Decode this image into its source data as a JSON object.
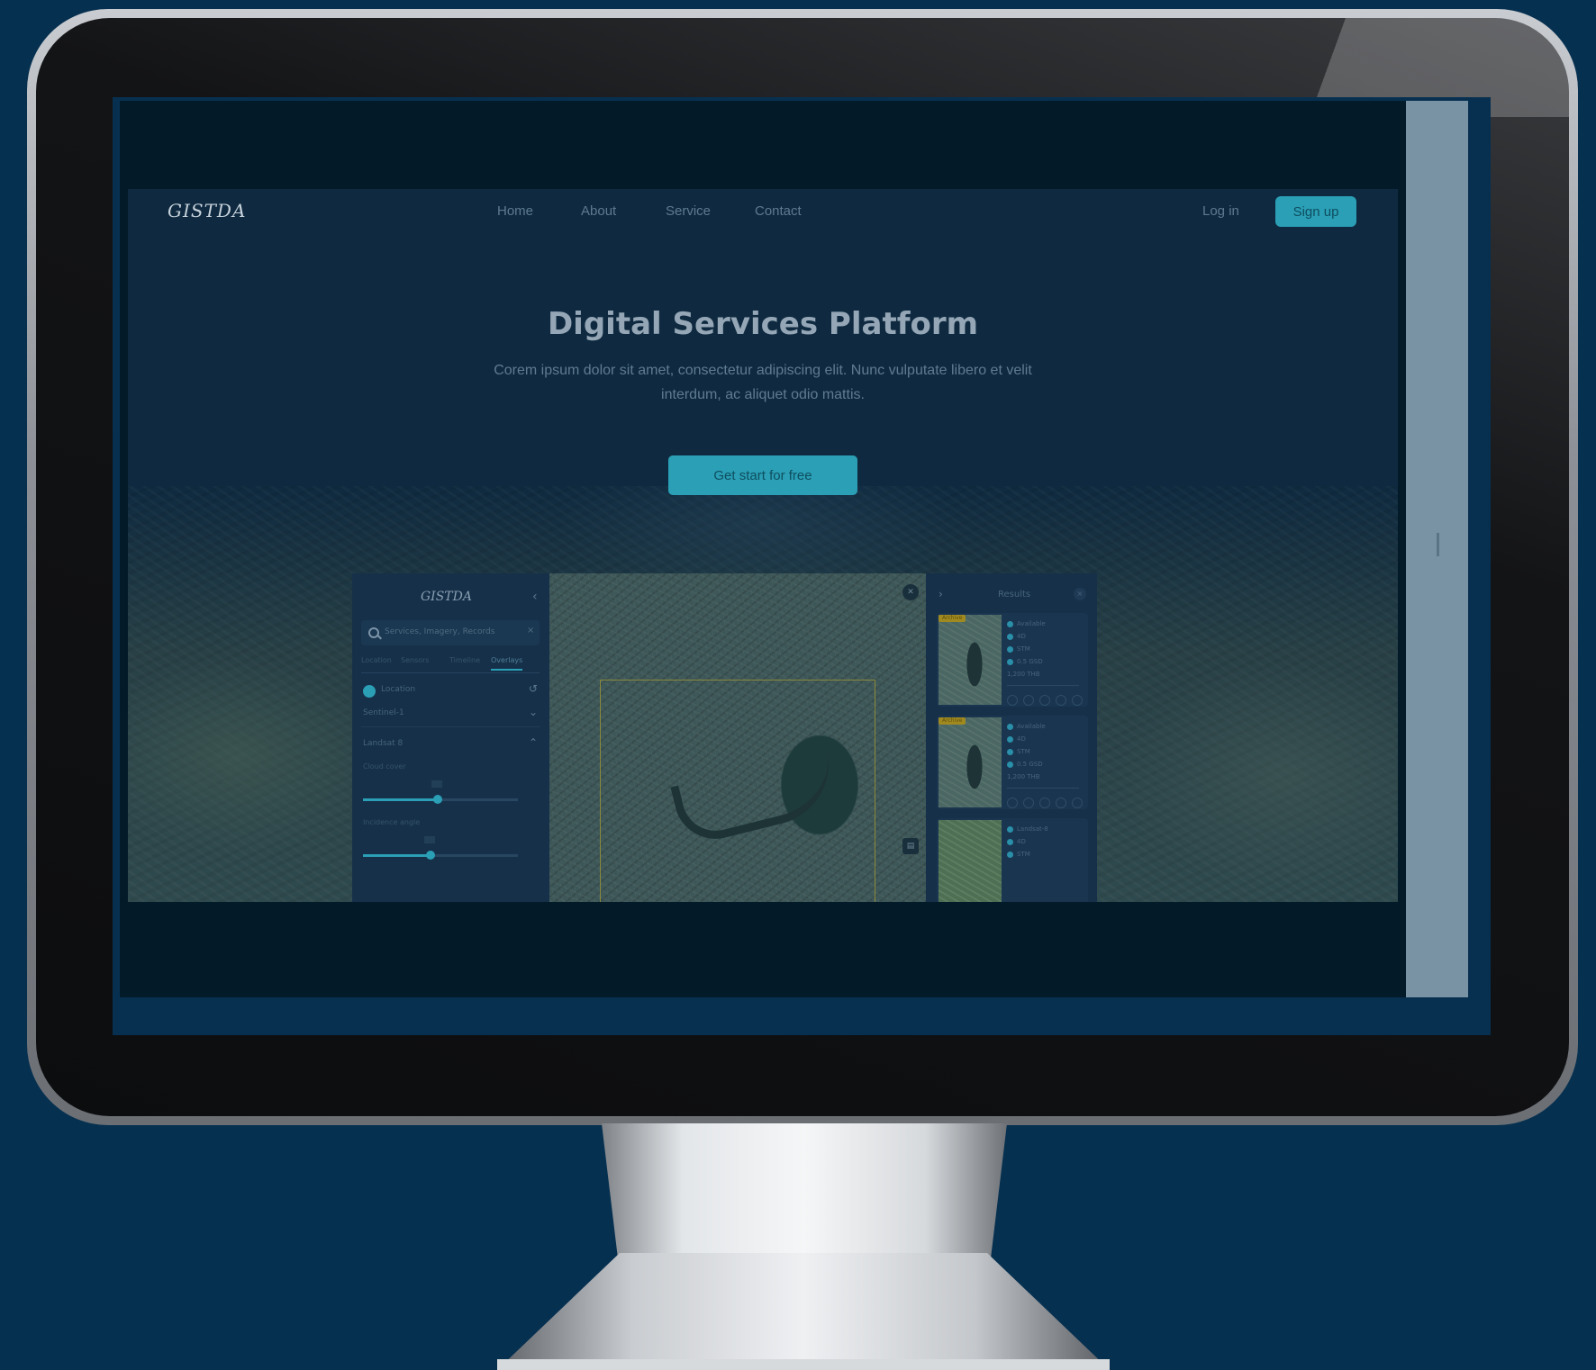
{
  "site": {
    "logo": "GISTDA",
    "nav": [
      "Home",
      "About",
      "Service",
      "Contact"
    ],
    "login": "Log in",
    "signup": "Sign up"
  },
  "hero": {
    "title": "Digital Services Platform",
    "subtitle": "Corem ipsum dolor sit amet, consectetur adipiscing elit. Nunc vulputate libero et velit interdum, ac aliquet odio mattis.",
    "cta": "Get start for free"
  },
  "app_preview": {
    "logo": "GISTDA",
    "search_placeholder": "Services, Imagery, Records",
    "search_clear": "×",
    "tabs": [
      "Location",
      "Sensors",
      "Timeline",
      "Overlays"
    ],
    "rows": [
      "Location",
      "Sentinel-1",
      "Landsat 8"
    ],
    "slider_labels": [
      "Cloud cover",
      "Incidence angle"
    ],
    "results_title": "Results",
    "results_close": "×",
    "cards": [
      {
        "badge": "Archive",
        "meta": [
          "Available",
          "4D",
          "STM",
          "0.5 GSD"
        ],
        "footer": "1,200 THB"
      },
      {
        "badge": "Archive",
        "meta": [
          "Available",
          "4D",
          "STM",
          "0.5 GSD"
        ],
        "footer": "1,200 THB"
      },
      {
        "badge": "",
        "meta": [
          "Landsat-8",
          "4D",
          "STM"
        ],
        "footer": ""
      }
    ]
  }
}
